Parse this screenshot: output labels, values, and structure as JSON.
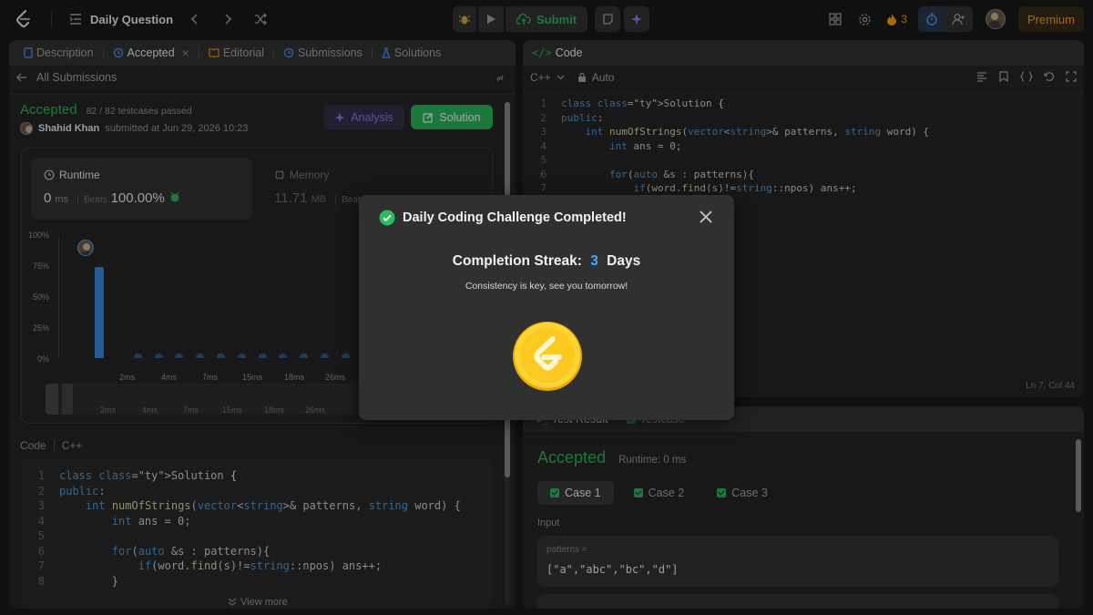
{
  "topbar": {
    "title": "Daily Question",
    "submit": "Submit",
    "streak_count": "3",
    "premium": "Premium"
  },
  "left_panel": {
    "tabs": [
      "Description",
      "Accepted",
      "Editorial",
      "Submissions",
      "Solutions"
    ],
    "back_label": "All Submissions",
    "status": "Accepted",
    "testcases": "82 / 82 testcases passed",
    "user": "Shahid Khan",
    "submitted_text": "submitted at Jun 29, 2026 10:23",
    "analysis_btn": "Analysis",
    "solution_btn": "Solution",
    "runtime_label": "Runtime",
    "runtime_value": "0",
    "runtime_unit": "ms",
    "beats_label": "Beats",
    "beats_value": "100.00%",
    "memory_label": "Memory",
    "memory_value": "11.71",
    "memory_unit": "MB",
    "memory_beats": "Beats",
    "code_label": "Code",
    "code_lang": "C++",
    "view_more": "View more"
  },
  "chart_data": {
    "type": "bar",
    "y_ticks": [
      "100%",
      "75%",
      "50%",
      "25%",
      "0%"
    ],
    "x_ticks": [
      "2ms",
      "4ms",
      "7ms",
      "15ms",
      "18ms",
      "26ms"
    ],
    "ylim": [
      0,
      100
    ],
    "values": [
      75,
      1,
      1,
      1,
      1,
      1,
      1,
      1,
      1,
      1,
      1,
      1,
      1,
      1
    ]
  },
  "code_panel": {
    "title": "Code",
    "lang": "C++",
    "mode": "Auto",
    "status": "Ln 7, Col 44"
  },
  "code_lines": [
    "class Solution {",
    "public:",
    "    int numOfStrings(vector<string>& patterns, string word) {",
    "        int ans = 0;",
    "",
    "        for(auto &s : patterns){",
    "            if(word.find(s)!=string::npos) ans++;",
    "        }"
  ],
  "test_panel": {
    "tab1": "Test Result",
    "tab2": "Testcase",
    "status": "Accepted",
    "runtime": "Runtime: 0 ms",
    "cases": [
      "Case 1",
      "Case 2",
      "Case 3"
    ],
    "input_label": "Input",
    "var_name": "patterns =",
    "var_value": "[\"a\",\"abc\",\"bc\",\"d\"]"
  },
  "modal": {
    "title": "Daily Coding Challenge Completed!",
    "streak_prefix": "Completion Streak:",
    "streak_value": "3",
    "streak_suffix": "Days",
    "message": "Consistency is key, see you tomorrow!"
  },
  "colors": {
    "accent_green": "#2cbb5d",
    "premium_orange": "#ffa116",
    "bar_blue": "#3a89e2",
    "coin_gold": "#fcd535"
  }
}
